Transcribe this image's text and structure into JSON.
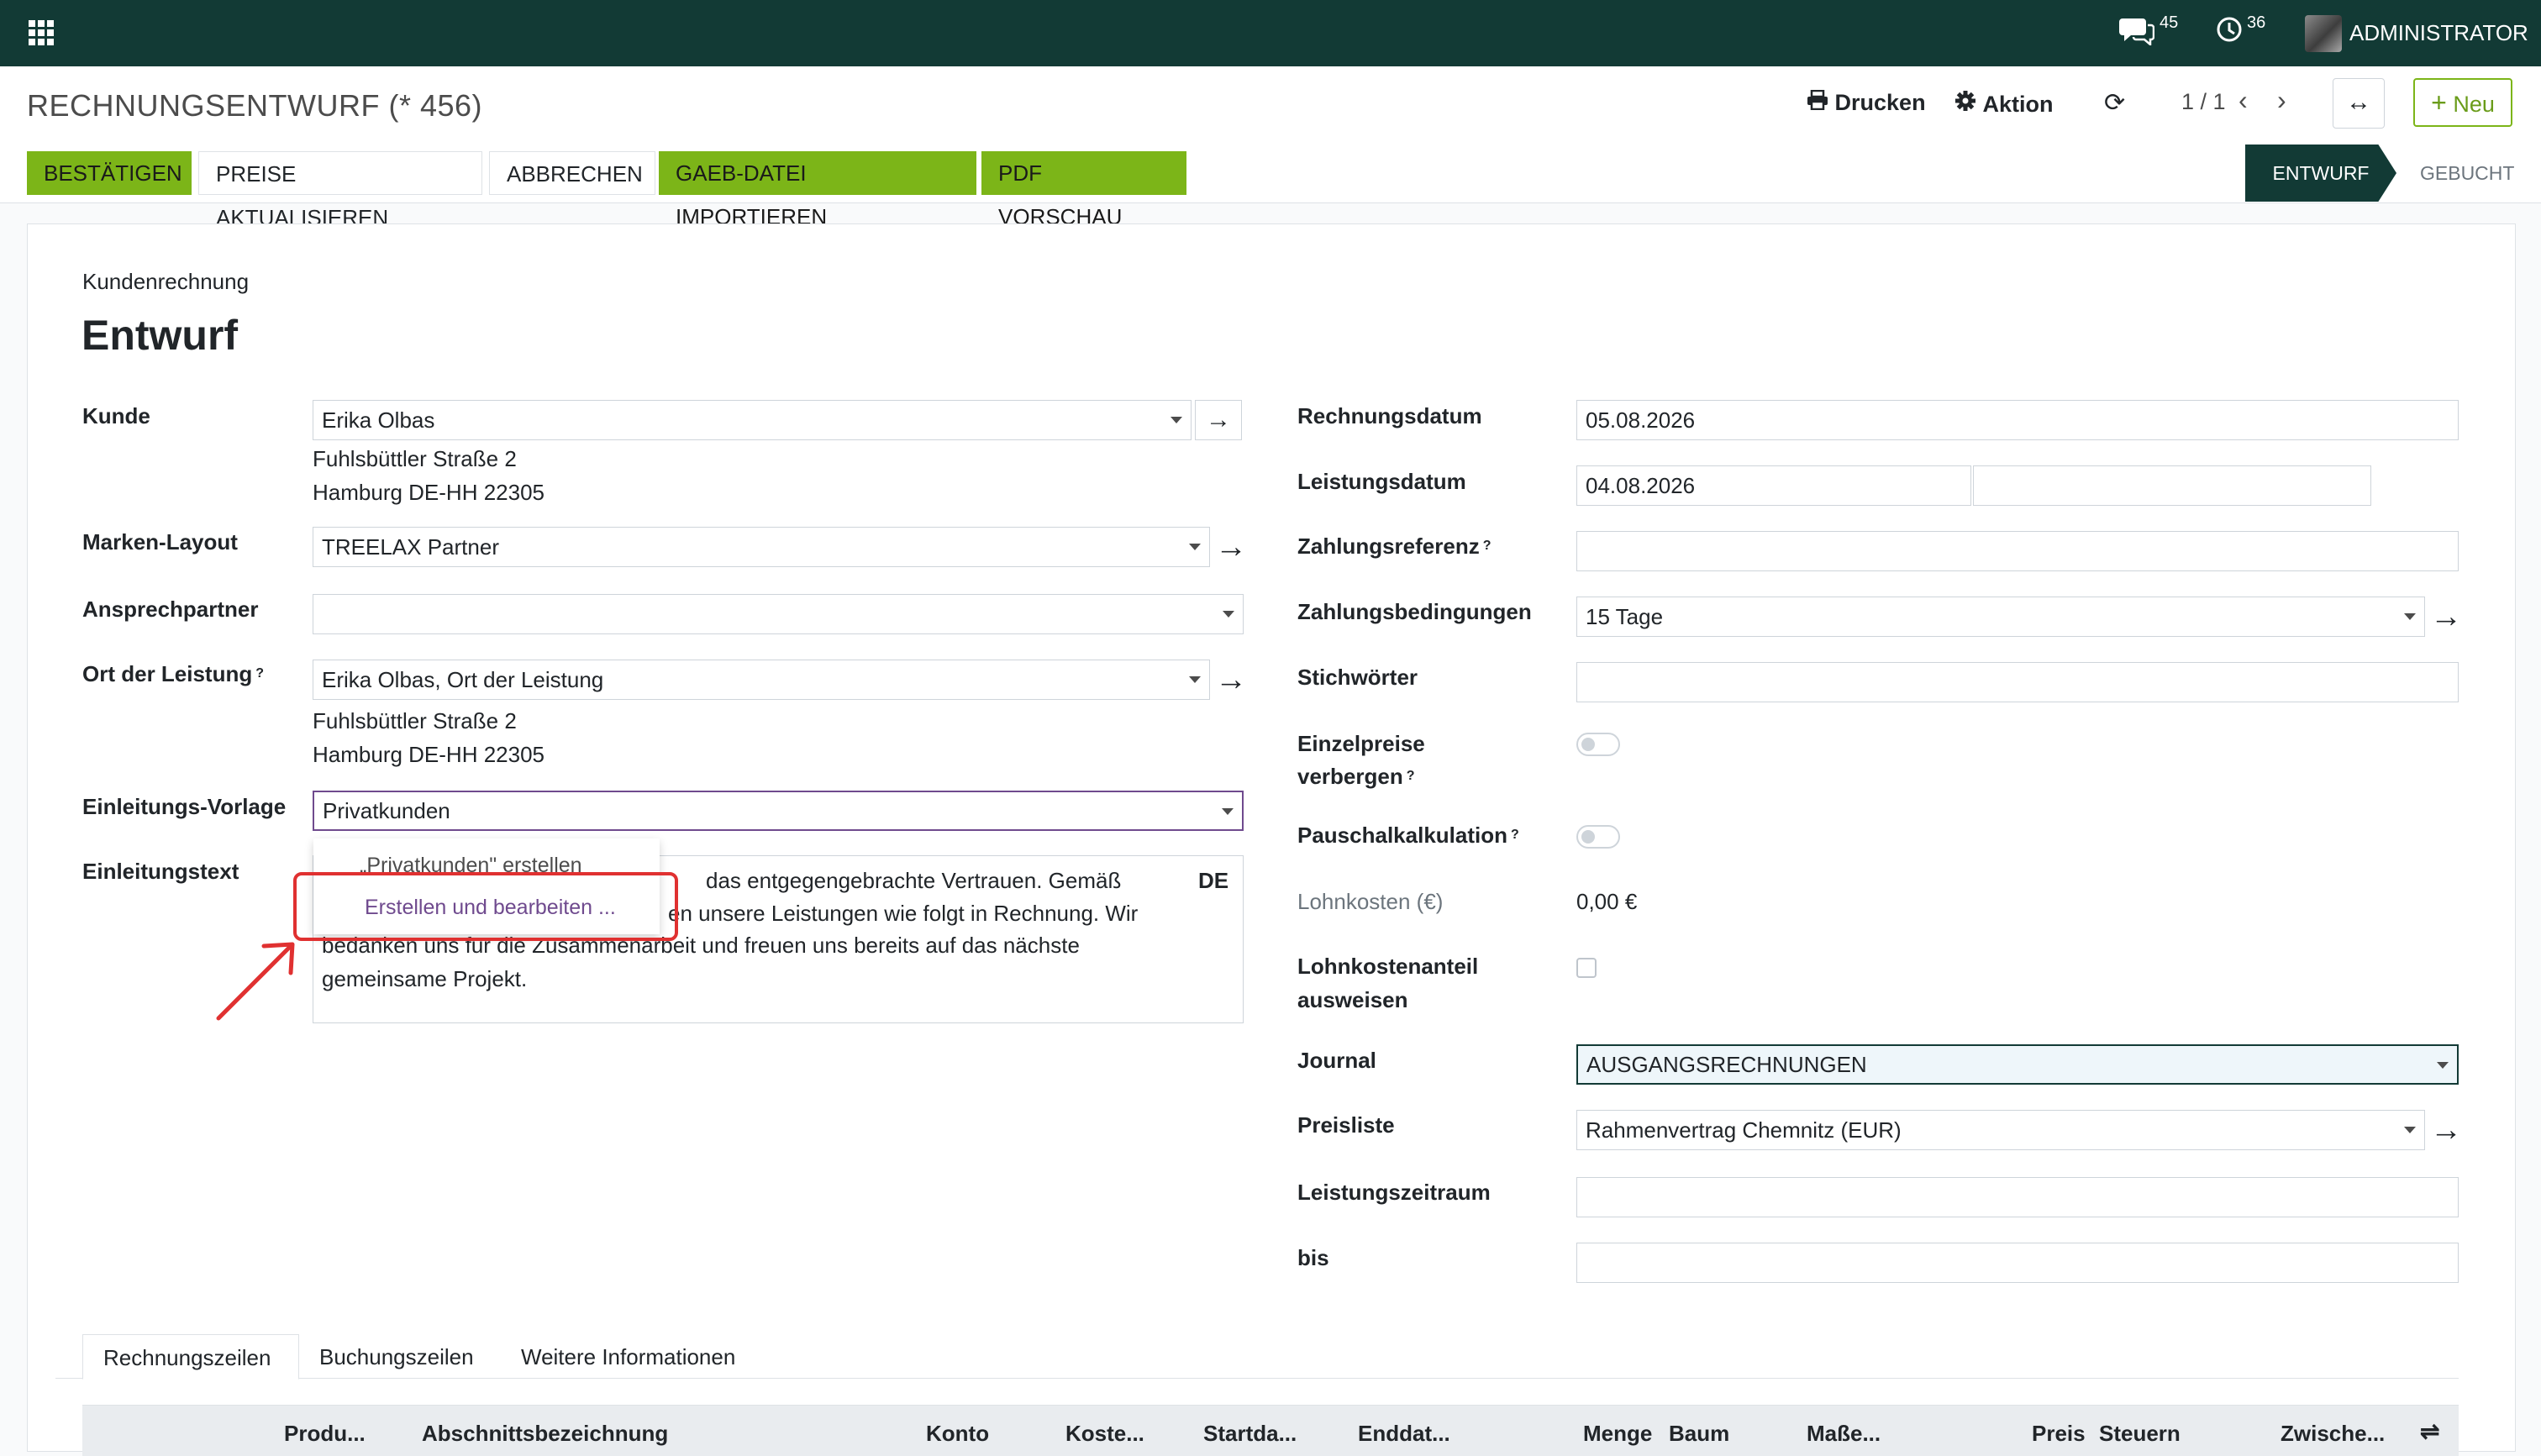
{
  "nav": {
    "messages_count": "45",
    "activities_count": "36",
    "user": "ADMINISTRATOR"
  },
  "control": {
    "breadcrumb": "RECHNUNGSENTWURF (* 456)",
    "print_label": "Drucken",
    "action_label": "Aktion",
    "pager": "1 / 1",
    "new_label": "Neu",
    "buttons": {
      "confirm": "BESTÄTIGEN",
      "update_prices": "PREISE AKTUALISIEREN",
      "cancel": "ABBRECHEN",
      "gaeb": "GAEB-DATEI IMPORTIEREN",
      "pdf": "PDF VORSCHAU"
    },
    "status": {
      "active": "ENTWURF",
      "next": "GEBUCHT"
    }
  },
  "form": {
    "type": "Kundenrechnung",
    "title": "Entwurf",
    "left": {
      "customer_label": "Kunde",
      "customer_value": "Erika Olbas",
      "customer_addr1": "Fuhlsbüttler Straße 2",
      "customer_addr2": "Hamburg DE-HH 22305",
      "brand_label": "Marken-Layout",
      "brand_value": "TREELAX Partner",
      "contact_label": "Ansprechpartner",
      "contact_value": "",
      "site_label": "Ort der Leistung",
      "site_value": "Erika Olbas, Ort der Leistung",
      "site_addr1": "Fuhlsbüttler Straße 2",
      "site_addr2": "Hamburg DE-HH 22305",
      "intro_template_label": "Einleitungs-Vorlage",
      "intro_template_value": "Privatkunden",
      "intro_text_label": "Einleitungstext",
      "intro_text_line1": "das entgegengebrachte Vertrauen. Gemäß",
      "intro_text_line2": "en unsere Leistungen wie folgt in Rechnung. Wir",
      "intro_text_line3": "bedanken uns für die Zusammenarbeit und freuen uns bereits auf das nächste",
      "intro_text_line4": "gemeinsame Projekt.",
      "intro_lang": "DE"
    },
    "right": {
      "invoice_date_label": "Rechnungsdatum",
      "invoice_date": "05.08.2026",
      "service_date_label": "Leistungsdatum",
      "service_date": "04.08.2026",
      "service_date_end": "",
      "payment_ref_label": "Zahlungsreferenz",
      "payment_ref": "",
      "payment_terms_label": "Zahlungsbedingungen",
      "payment_terms": "15 Tage",
      "keywords_label": "Stichwörter",
      "keywords": "",
      "hide_prices_label1": "Einzelpreise",
      "hide_prices_label2": "verbergen",
      "lump_sum_label": "Pauschalkalkulation",
      "labor_cost_label": "Lohnkosten (€)",
      "labor_cost_value": "0,00 €",
      "labor_share_label1": "Lohnkostenanteil",
      "labor_share_label2": "ausweisen",
      "journal_label": "Journal",
      "journal_value": "AUSGANGSRECHNUNGEN",
      "pricelist_label": "Preisliste",
      "pricelist_value": "Rahmenvertrag Chemnitz (EUR)",
      "period_label": "Leistungszeitraum",
      "period_value": "",
      "until_label": "bis",
      "until_value": ""
    }
  },
  "dropdown": {
    "create_item": "„Privatkunden\" erstellen",
    "create_edit_item": "Erstellen und bearbeiten ..."
  },
  "tabs": [
    "Rechnungszeilen",
    "Buchungszeilen",
    "Weitere Informationen"
  ],
  "table_headers": [
    "Produ...",
    "Abschnittsbezeichnung",
    "Konto",
    "Koste...",
    "Startda...",
    "Enddat...",
    "Menge",
    "Baum",
    "Maße...",
    "Preis",
    "Steuern",
    "Zwische..."
  ],
  "colors": {
    "nav_bg": "#123a35",
    "accent_green": "#7cb518",
    "link_purple": "#6f4a8e",
    "annotation_red": "#e03131"
  }
}
